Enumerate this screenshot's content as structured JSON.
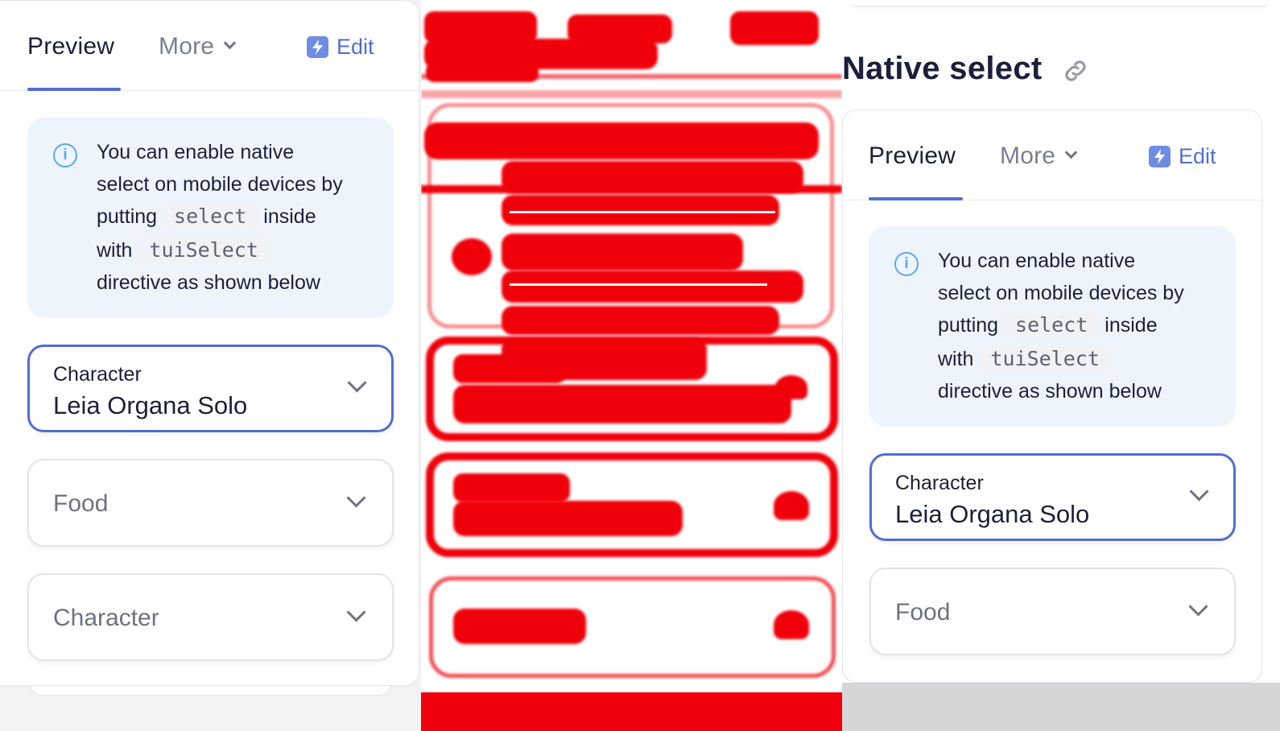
{
  "left": {
    "tabs": {
      "preview": "Preview",
      "more": "More",
      "edit": "Edit"
    },
    "notice": {
      "line1": "You can enable native",
      "line2": "select on mobile devices by",
      "line3_pre": "putting",
      "code1": "select",
      "line3_post": "inside",
      "line4_pre": "with",
      "code2": "tuiSelect",
      "line5": "directive as shown below"
    },
    "fields": [
      {
        "label": "Character",
        "value": "Leia Organa Solo"
      },
      {
        "placeholder": "Food"
      },
      {
        "placeholder": "Character"
      }
    ]
  },
  "right": {
    "heading": "Native select",
    "tabs": {
      "preview": "Preview",
      "more": "More",
      "edit": "Edit"
    },
    "notice": {
      "line1": "You can enable native",
      "line2": "select on mobile devices by",
      "line3_pre": "putting",
      "code1": "select",
      "line3_post": "inside",
      "line4_pre": "with",
      "code2": "tuiSelect",
      "line5": "directive as shown below"
    },
    "fields": [
      {
        "label": "Character",
        "value": "Leia Organa Solo"
      },
      {
        "placeholder": "Food"
      }
    ]
  },
  "colors": {
    "accent": "#526ed3",
    "info": "#5ca8ee",
    "redaction": "#f0000a"
  },
  "icons": [
    "chevron-down-icon",
    "bolt-icon",
    "info-icon",
    "link-icon"
  ]
}
